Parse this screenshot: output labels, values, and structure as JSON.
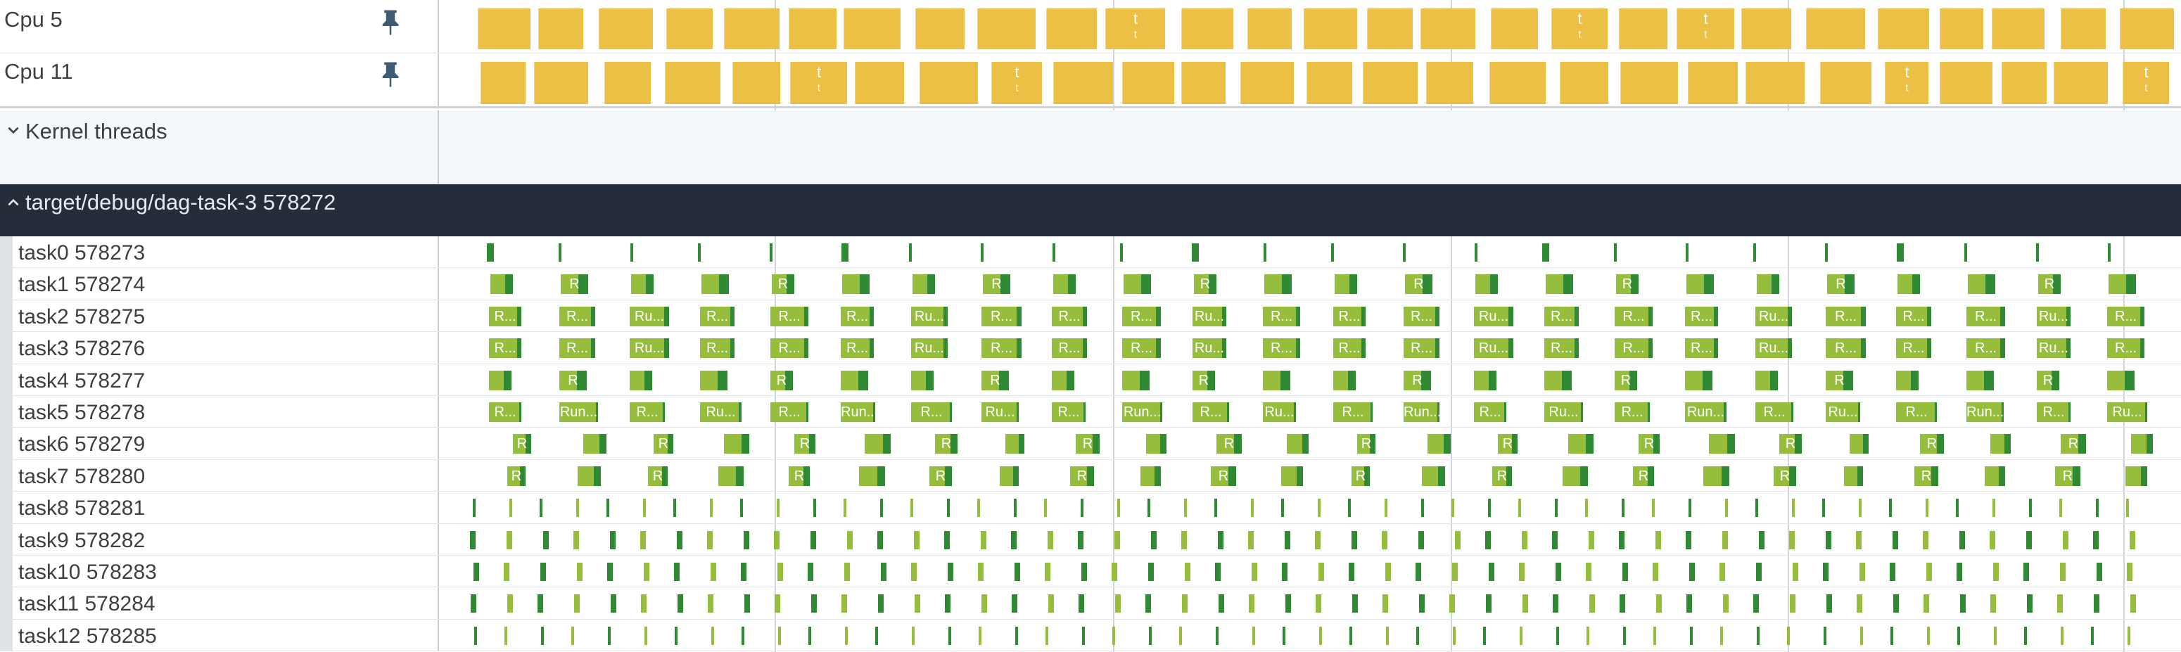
{
  "cpus": [
    {
      "id": "cpu5",
      "label": "Cpu 5",
      "pin_icon": "pin-icon",
      "t_marks": [
        1628,
        2222,
        2437
      ]
    },
    {
      "id": "cpu11",
      "label": "Cpu 11",
      "pin_icon": "pin-icon",
      "t_marks": [
        1124,
        1413,
        2733,
        3030
      ]
    }
  ],
  "kernel_group": {
    "label": "Kernel threads",
    "icon": "chevron-down-icon"
  },
  "process": {
    "label": "target/debug/dag-task-3 578272",
    "icon": "chevron-up-icon"
  },
  "threads": [
    {
      "label": "task0 578273",
      "pattern": "sparse"
    },
    {
      "label": "task1 578274",
      "pattern": "R"
    },
    {
      "label": "task2 578275",
      "pattern": "R..."
    },
    {
      "label": "task3 578276",
      "pattern": "R..."
    },
    {
      "label": "task4 578277",
      "pattern": "R"
    },
    {
      "label": "task5 578278",
      "pattern": "Run"
    },
    {
      "label": "task6 578279",
      "pattern": "R-late"
    },
    {
      "label": "task7 578280",
      "pattern": "R-late"
    },
    {
      "label": "task8 578281",
      "pattern": "ticks"
    },
    {
      "label": "task9 578282",
      "pattern": "ticks"
    },
    {
      "label": "task10 578283",
      "pattern": "ticks"
    },
    {
      "label": "task11 578284",
      "pattern": "ticks"
    },
    {
      "label": "task12 578285",
      "pattern": "ticks"
    }
  ],
  "slice_labels": {
    "short": "R",
    "ellipsis": "R...",
    "run": "Ru...",
    "run_full": "Run...",
    "t": "t"
  },
  "colors": {
    "cpu_slice": "#ecc044",
    "thread_running": "#96be3c",
    "thread_dark": "#2f8a33",
    "process_header_bg": "#262d3a",
    "grid": "#d2d6dc"
  }
}
